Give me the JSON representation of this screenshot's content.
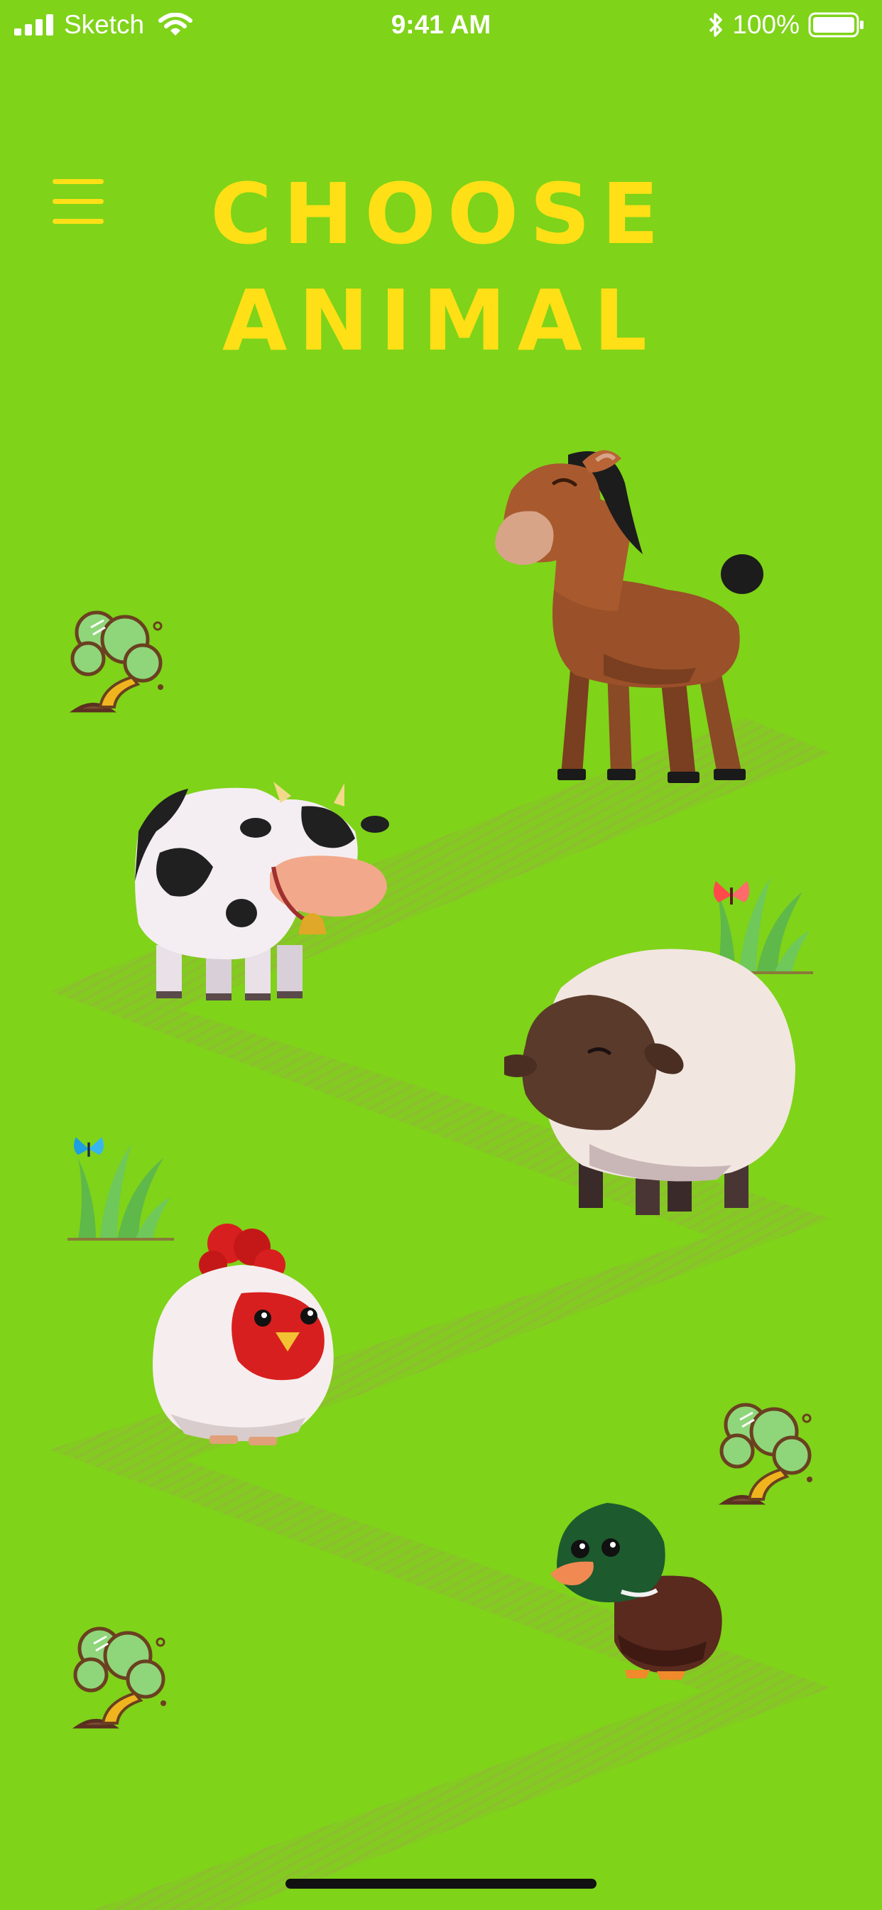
{
  "status_bar": {
    "carrier": "Sketch",
    "time": "9:41 AM",
    "battery": "100%"
  },
  "header": {
    "title_line1": "CHOOSE",
    "title_line2": "ANIMAL"
  },
  "animals": [
    {
      "name": "horse"
    },
    {
      "name": "cow"
    },
    {
      "name": "sheep"
    },
    {
      "name": "chicken"
    },
    {
      "name": "duck"
    }
  ],
  "colors": {
    "background": "#7fd319",
    "title": "#ffe016",
    "path_stripe": "#8cbd2f"
  },
  "icons": [
    "signal-icon",
    "wifi-icon",
    "bluetooth-icon",
    "battery-icon",
    "menu-icon",
    "tree-icon",
    "grass-icon",
    "butterfly-icon"
  ]
}
